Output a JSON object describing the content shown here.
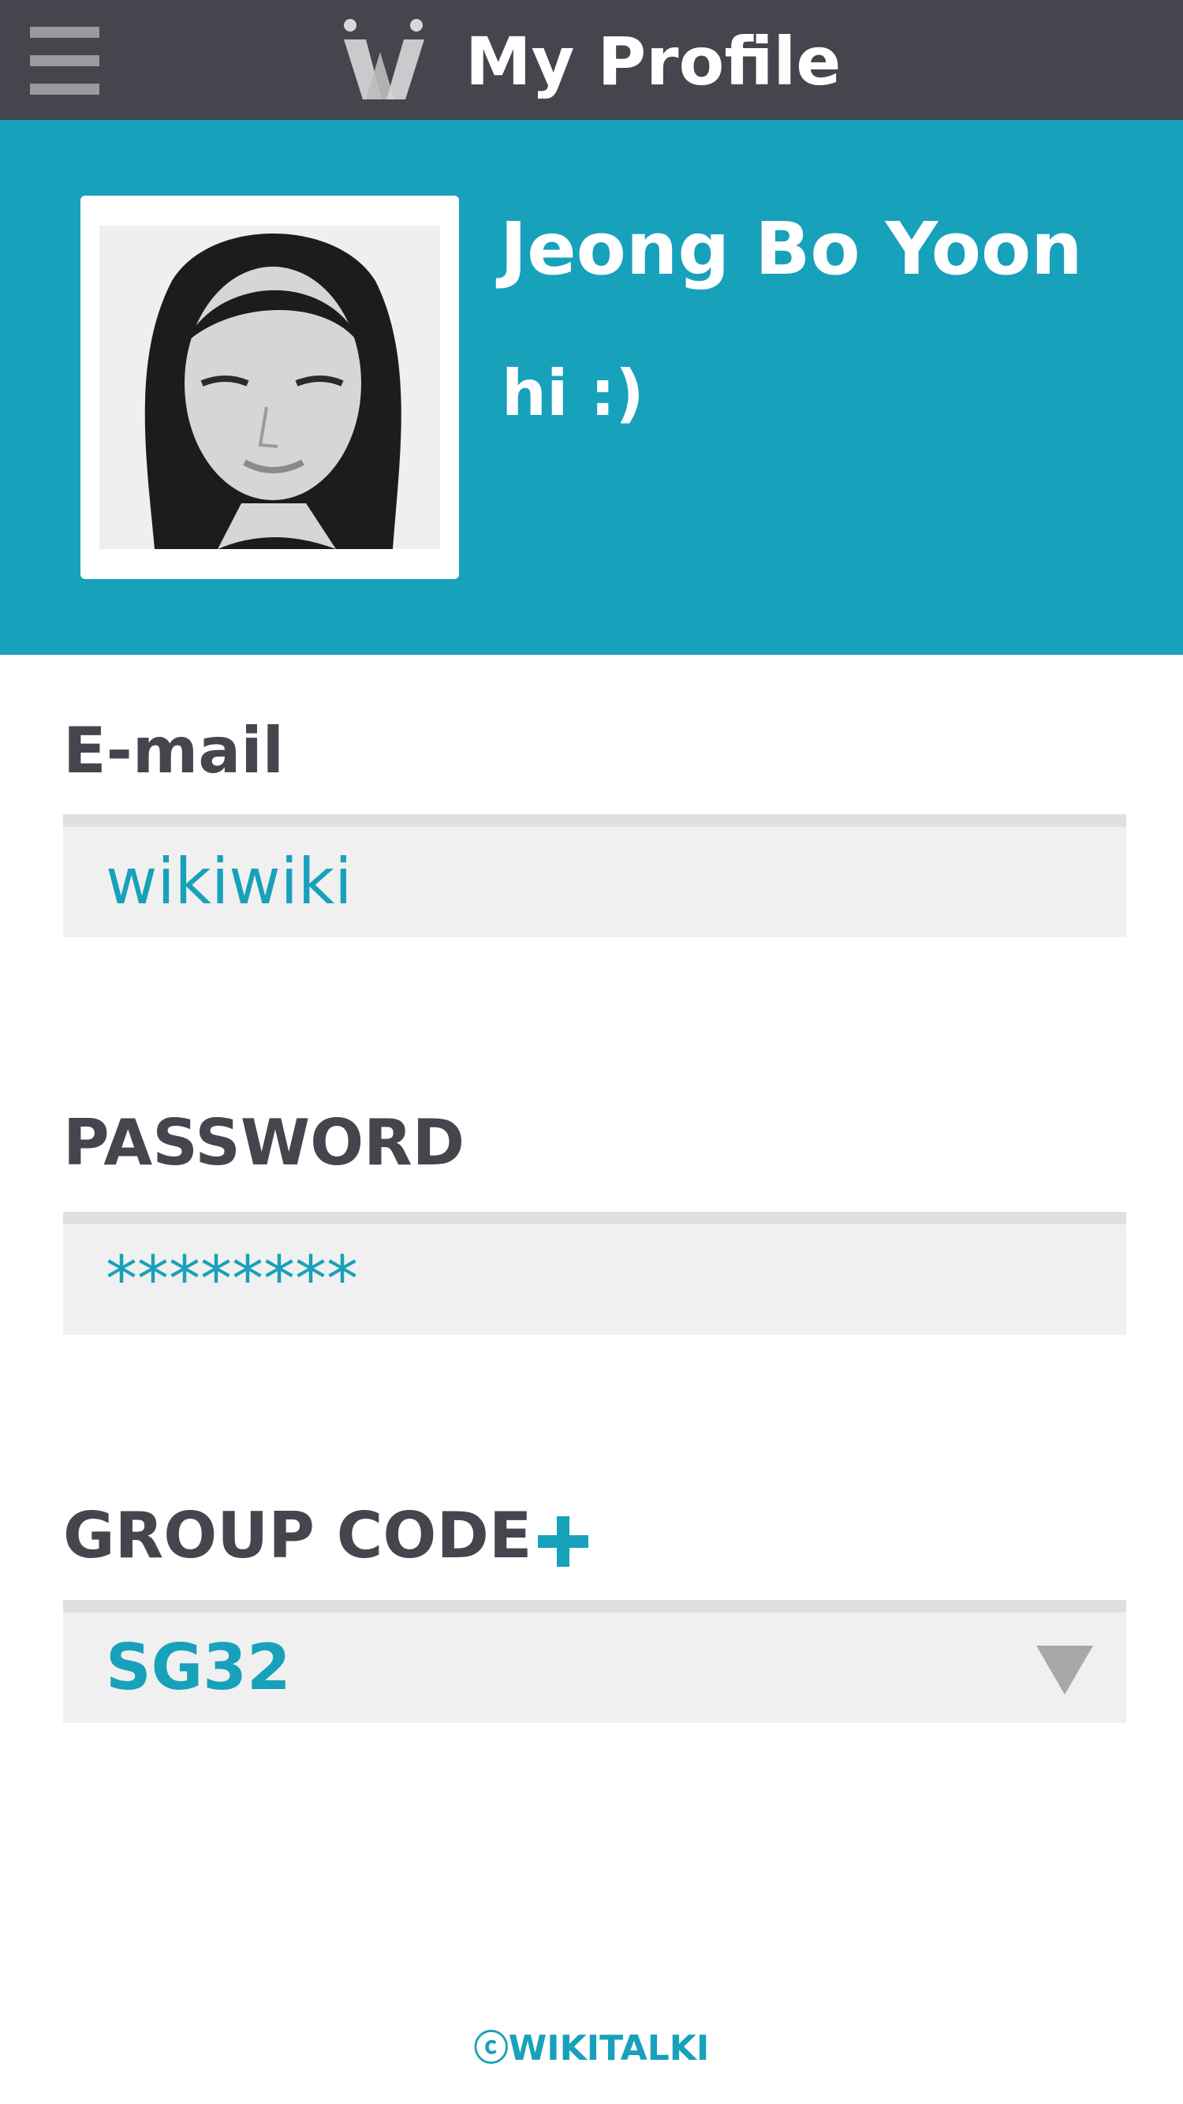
{
  "header": {
    "title": "My Profile",
    "menu_icon": "hamburger-menu-icon",
    "logo_icon": "wikitalki-logo-icon"
  },
  "profile": {
    "name": "Jeong Bo Yoon",
    "status": "hi :)"
  },
  "form": {
    "email": {
      "label": "E-mail",
      "value": "wikiwiki"
    },
    "password": {
      "label": "PASSWORD",
      "value": "********"
    },
    "group_code": {
      "label": "GROUP CODE",
      "value": "SG32",
      "add_icon": "plus-icon",
      "dropdown_icon": "dropdown-arrow-icon"
    }
  },
  "footer": {
    "copyright": "ⓒWIKITALKI"
  },
  "colors": {
    "header_bg": "#46454d",
    "accent": "#17a1bb",
    "field_bg": "#f0f0f0",
    "label_text": "#46454d"
  }
}
